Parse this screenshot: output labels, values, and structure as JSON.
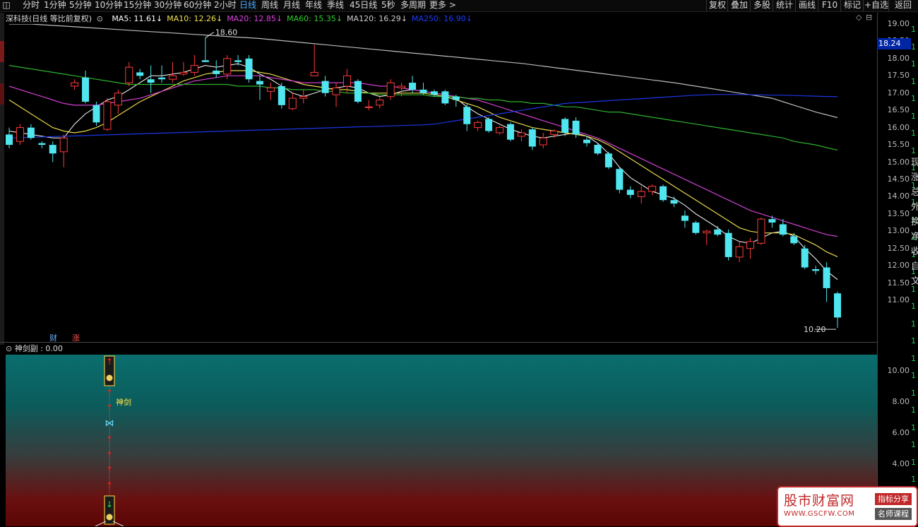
{
  "toolbar": {
    "period_tabs": [
      "分时",
      "1分钟",
      "5分钟",
      "10分钟",
      "15分钟",
      "30分钟",
      "60分钟",
      "2小时",
      "日线",
      "周线",
      "月线",
      "年线",
      "季线",
      "45日线",
      "5秒",
      "多周期",
      "更多 >"
    ],
    "active_tab": "日线",
    "right_buttons": [
      "复权",
      "叠加",
      "多股",
      "统计",
      "画线",
      "F10",
      "标记",
      "+自选",
      "返回"
    ]
  },
  "header": {
    "title": "深科技(日线 等比前复权)",
    "ma": [
      {
        "label": "MA5: 11.61",
        "arrow": "↓",
        "color": "#ffffff"
      },
      {
        "label": "MA10: 12.26",
        "arrow": "↓",
        "color": "#f0e050"
      },
      {
        "label": "MA20: 12.85",
        "arrow": "↓",
        "color": "#e040e0"
      },
      {
        "label": "MA60: 15.35",
        "arrow": "↓",
        "color": "#33cc33"
      },
      {
        "label": "MA120: 16.29",
        "arrow": "↓",
        "color": "#cccccc"
      },
      {
        "label": "MA250: 16.90",
        "arrow": "↓",
        "color": "#1a3cff"
      }
    ]
  },
  "price_axis": {
    "ticks": [
      "19.00",
      "18.50",
      "18.00",
      "17.50",
      "17.00",
      "16.50",
      "16.00",
      "15.50",
      "15.00",
      "14.50",
      "14.00",
      "13.50",
      "13.00",
      "12.50",
      "12.00",
      "11.50",
      "11.00"
    ],
    "current_price": "18.24"
  },
  "annotations": {
    "high_label": "18.60",
    "low_label": "10.20",
    "badge_cai": "财",
    "badge_zhang": "涨"
  },
  "side_text": [
    "现",
    "涨",
    "总",
    "外",
    "换",
    "净",
    "收",
    "自",
    "文"
  ],
  "side_nums": [
    "1",
    "1",
    "1",
    "1",
    "1",
    "1",
    "1",
    "1",
    "1",
    "1",
    "1",
    "1",
    "1",
    "1",
    "1",
    "1",
    "1",
    "1",
    "1",
    "1",
    "1",
    "1",
    "1",
    "1",
    "1",
    "1",
    "1",
    "1",
    "1"
  ],
  "sub_panel": {
    "title": "神剑副 : 0.00",
    "ticks": [
      "10.00",
      "8.00",
      "6.00",
      "4.00"
    ],
    "signal_label": "神剑"
  },
  "watermark": {
    "title": "股市财富网",
    "url": "WWW.GSCFW.COM",
    "btn1": "指标分享",
    "btn2": "名师课程"
  },
  "chart_data": {
    "type": "candlestick",
    "ylim": [
      10.0,
      19.1
    ],
    "candles": [
      [
        15.8,
        15.5,
        16.0,
        15.4
      ],
      [
        15.6,
        16.0,
        16.1,
        15.5
      ],
      [
        16.0,
        15.7,
        16.1,
        15.65
      ],
      [
        15.55,
        15.5,
        15.6,
        15.4
      ],
      [
        15.5,
        15.25,
        15.6,
        15.0
      ],
      [
        15.3,
        15.7,
        15.8,
        14.85
      ],
      [
        17.2,
        17.3,
        17.4,
        17.1
      ],
      [
        17.45,
        16.75,
        17.65,
        16.7
      ],
      [
        16.65,
        16.15,
        16.75,
        16.05
      ],
      [
        15.95,
        16.75,
        16.85,
        15.9
      ],
      [
        16.65,
        17.0,
        17.1,
        16.4
      ],
      [
        17.3,
        17.75,
        17.9,
        17.2
      ],
      [
        17.6,
        17.5,
        17.7,
        17.4
      ],
      [
        17.4,
        17.3,
        17.8,
        17.0
      ],
      [
        17.45,
        17.4,
        17.8,
        17.3
      ],
      [
        17.4,
        17.5,
        17.9,
        17.3
      ],
      [
        17.55,
        17.6,
        17.9,
        17.5
      ],
      [
        17.6,
        17.8,
        18.1,
        17.5
      ],
      [
        17.95,
        17.9,
        18.6,
        17.9
      ],
      [
        17.65,
        17.55,
        17.95,
        17.45
      ],
      [
        17.55,
        18.0,
        18.1,
        17.4
      ],
      [
        17.95,
        17.9,
        18.1,
        17.8
      ],
      [
        18.0,
        17.4,
        18.1,
        17.3
      ],
      [
        17.35,
        17.25,
        17.5,
        16.8
      ],
      [
        17.05,
        17.15,
        17.3,
        16.8
      ],
      [
        17.2,
        16.65,
        17.3,
        16.55
      ],
      [
        16.55,
        16.85,
        17.0,
        16.5
      ],
      [
        16.85,
        16.9,
        17.1,
        16.7
      ],
      [
        17.5,
        17.6,
        18.4,
        17.5
      ],
      [
        17.35,
        17.0,
        17.5,
        16.9
      ],
      [
        16.95,
        17.15,
        17.3,
        16.6
      ],
      [
        17.2,
        17.5,
        17.7,
        17.0
      ],
      [
        17.35,
        16.75,
        17.4,
        16.7
      ],
      [
        16.6,
        16.6,
        16.8,
        16.5
      ],
      [
        16.65,
        16.8,
        16.9,
        16.55
      ],
      [
        16.9,
        17.3,
        17.4,
        16.8
      ],
      [
        17.15,
        17.2,
        17.3,
        16.9
      ],
      [
        17.3,
        17.1,
        17.5,
        17.0
      ],
      [
        17.1,
        17.0,
        17.3,
        16.95
      ],
      [
        17.05,
        16.95,
        17.1,
        16.9
      ],
      [
        17.05,
        16.7,
        17.1,
        16.65
      ],
      [
        16.9,
        16.8,
        16.95,
        16.6
      ],
      [
        16.6,
        16.1,
        16.7,
        15.9
      ],
      [
        16.0,
        16.15,
        16.2,
        15.9
      ],
      [
        16.25,
        15.9,
        16.3,
        15.85
      ],
      [
        15.85,
        16.0,
        16.05,
        15.8
      ],
      [
        16.1,
        15.65,
        16.15,
        15.6
      ],
      [
        15.75,
        15.85,
        15.95,
        15.6
      ],
      [
        15.95,
        15.45,
        16.0,
        15.35
      ],
      [
        15.5,
        15.7,
        15.85,
        15.4
      ],
      [
        15.8,
        15.9,
        15.95,
        15.7
      ],
      [
        16.25,
        15.85,
        16.3,
        15.75
      ],
      [
        16.2,
        15.8,
        16.3,
        15.7
      ],
      [
        15.65,
        15.55,
        15.75,
        15.45
      ],
      [
        15.5,
        15.25,
        15.55,
        15.2
      ],
      [
        15.25,
        14.85,
        15.3,
        14.8
      ],
      [
        14.8,
        14.2,
        14.85,
        14.1
      ],
      [
        14.2,
        14.05,
        14.3,
        13.95
      ],
      [
        14.0,
        14.15,
        14.3,
        13.8
      ],
      [
        14.15,
        14.3,
        14.35,
        14.05
      ],
      [
        14.3,
        13.9,
        14.35,
        13.85
      ],
      [
        13.9,
        13.8,
        14.0,
        13.7
      ],
      [
        13.45,
        13.3,
        13.6,
        13.1
      ],
      [
        13.25,
        12.95,
        13.3,
        12.9
      ],
      [
        12.95,
        13.0,
        13.05,
        12.6
      ],
      [
        13.05,
        12.9,
        13.15,
        12.85
      ],
      [
        12.95,
        12.25,
        13.05,
        12.15
      ],
      [
        12.25,
        12.55,
        12.7,
        12.1
      ],
      [
        12.5,
        12.7,
        12.8,
        12.2
      ],
      [
        12.65,
        13.35,
        13.4,
        12.6
      ],
      [
        13.35,
        13.25,
        13.45,
        13.1
      ],
      [
        13.2,
        12.9,
        13.35,
        12.85
      ],
      [
        12.85,
        12.65,
        12.95,
        12.6
      ],
      [
        12.5,
        11.95,
        12.6,
        11.9
      ],
      [
        11.9,
        11.85,
        12.0,
        11.75
      ],
      [
        11.95,
        11.35,
        12.1,
        10.95
      ],
      [
        11.2,
        10.5,
        11.25,
        10.2
      ]
    ],
    "ma": {
      "MA5": [
        15.9,
        15.85,
        15.8,
        15.75,
        15.7,
        15.7,
        16.1,
        16.4,
        16.6,
        16.8,
        16.9,
        17.1,
        17.3,
        17.5,
        17.5,
        17.55,
        17.6,
        17.7,
        17.8,
        17.75,
        17.8,
        17.85,
        17.75,
        17.55,
        17.4,
        17.2,
        17.0,
        16.9,
        17.0,
        17.1,
        17.15,
        17.2,
        17.15,
        17.0,
        16.9,
        16.95,
        17.05,
        17.1,
        17.05,
        17.0,
        16.95,
        16.85,
        16.6,
        16.4,
        16.25,
        16.1,
        15.95,
        15.85,
        15.75,
        15.7,
        15.75,
        15.8,
        15.85,
        15.75,
        15.55,
        15.25,
        14.85,
        14.55,
        14.35,
        14.15,
        14.05,
        13.95,
        13.75,
        13.5,
        13.3,
        13.1,
        12.85,
        12.7,
        12.65,
        12.8,
        12.95,
        13.0,
        12.85,
        12.5,
        12.2,
        11.85,
        11.6
      ],
      "MA10": [
        16.8,
        16.6,
        16.4,
        16.2,
        16.0,
        15.9,
        15.85,
        15.9,
        16.0,
        16.15,
        16.35,
        16.55,
        16.75,
        16.9,
        17.05,
        17.2,
        17.35,
        17.45,
        17.55,
        17.6,
        17.65,
        17.65,
        17.65,
        17.6,
        17.55,
        17.45,
        17.35,
        17.25,
        17.2,
        17.15,
        17.1,
        17.1,
        17.05,
        17.0,
        17.0,
        17.0,
        17.0,
        17.0,
        17.0,
        16.95,
        16.9,
        16.8,
        16.7,
        16.6,
        16.45,
        16.3,
        16.2,
        16.1,
        16.0,
        15.95,
        15.9,
        15.85,
        15.8,
        15.75,
        15.65,
        15.5,
        15.3,
        15.1,
        14.9,
        14.7,
        14.5,
        14.3,
        14.1,
        13.9,
        13.7,
        13.5,
        13.3,
        13.1,
        13.0,
        12.95,
        12.95,
        12.95,
        12.9,
        12.75,
        12.6,
        12.4,
        12.26
      ],
      "MA20": [
        17.2,
        17.1,
        17.0,
        16.9,
        16.8,
        16.7,
        16.65,
        16.65,
        16.65,
        16.7,
        16.75,
        16.8,
        16.85,
        16.95,
        17.05,
        17.15,
        17.25,
        17.35,
        17.4,
        17.45,
        17.5,
        17.5,
        17.5,
        17.5,
        17.45,
        17.4,
        17.35,
        17.3,
        17.3,
        17.3,
        17.3,
        17.3,
        17.3,
        17.25,
        17.2,
        17.2,
        17.15,
        17.1,
        17.05,
        17.0,
        16.95,
        16.9,
        16.85,
        16.8,
        16.7,
        16.6,
        16.5,
        16.4,
        16.3,
        16.2,
        16.1,
        16.0,
        15.9,
        15.8,
        15.7,
        15.55,
        15.4,
        15.25,
        15.1,
        14.95,
        14.8,
        14.65,
        14.5,
        14.35,
        14.2,
        14.05,
        13.9,
        13.75,
        13.6,
        13.5,
        13.4,
        13.3,
        13.2,
        13.1,
        13.0,
        12.9,
        12.85
      ],
      "MA60": [
        17.8,
        17.75,
        17.7,
        17.65,
        17.6,
        17.55,
        17.5,
        17.45,
        17.4,
        17.35,
        17.3,
        17.25,
        17.25,
        17.25,
        17.25,
        17.25,
        17.25,
        17.25,
        17.25,
        17.25,
        17.25,
        17.2,
        17.2,
        17.2,
        17.15,
        17.15,
        17.1,
        17.1,
        17.1,
        17.05,
        17.05,
        17.0,
        17.0,
        17.0,
        16.95,
        16.95,
        16.95,
        16.95,
        16.95,
        16.9,
        16.9,
        16.9,
        16.85,
        16.85,
        16.8,
        16.8,
        16.75,
        16.75,
        16.7,
        16.7,
        16.65,
        16.6,
        16.6,
        16.55,
        16.5,
        16.45,
        16.45,
        16.4,
        16.35,
        16.3,
        16.25,
        16.2,
        16.15,
        16.1,
        16.05,
        16.0,
        15.95,
        15.9,
        15.85,
        15.8,
        15.75,
        15.7,
        15.6,
        15.55,
        15.5,
        15.42,
        15.35
      ],
      "MA120": [
        19.0,
        19.0,
        19.0,
        18.98,
        18.96,
        18.94,
        18.92,
        18.9,
        18.88,
        18.86,
        18.84,
        18.82,
        18.8,
        18.78,
        18.76,
        18.74,
        18.72,
        18.7,
        18.68,
        18.66,
        18.64,
        18.62,
        18.6,
        18.58,
        18.55,
        18.52,
        18.49,
        18.46,
        18.43,
        18.4,
        18.37,
        18.34,
        18.31,
        18.28,
        18.25,
        18.22,
        18.19,
        18.16,
        18.13,
        18.1,
        18.07,
        18.04,
        18.01,
        17.98,
        17.95,
        17.92,
        17.89,
        17.86,
        17.82,
        17.78,
        17.74,
        17.7,
        17.66,
        17.62,
        17.58,
        17.54,
        17.5,
        17.46,
        17.42,
        17.38,
        17.34,
        17.3,
        17.25,
        17.2,
        17.15,
        17.1,
        17.05,
        17.0,
        16.95,
        16.9,
        16.85,
        16.75,
        16.65,
        16.55,
        16.45,
        16.37,
        16.29
      ],
      "MA250": [
        15.7,
        15.71,
        15.72,
        15.73,
        15.74,
        15.75,
        15.76,
        15.77,
        15.78,
        15.79,
        15.8,
        15.81,
        15.82,
        15.83,
        15.84,
        15.85,
        15.86,
        15.87,
        15.88,
        15.89,
        15.9,
        15.91,
        15.92,
        15.93,
        15.94,
        15.95,
        15.96,
        15.97,
        15.98,
        15.99,
        16.0,
        16.01,
        16.02,
        16.03,
        16.04,
        16.05,
        16.06,
        16.07,
        16.08,
        16.1,
        16.15,
        16.2,
        16.25,
        16.3,
        16.35,
        16.4,
        16.45,
        16.5,
        16.55,
        16.6,
        16.65,
        16.7,
        16.72,
        16.74,
        16.76,
        16.78,
        16.8,
        16.82,
        16.84,
        16.86,
        16.88,
        16.9,
        16.92,
        16.94,
        16.95,
        16.96,
        16.96,
        16.96,
        16.95,
        16.95,
        16.94,
        16.94,
        16.93,
        16.92,
        16.91,
        16.9,
        16.9
      ]
    }
  }
}
